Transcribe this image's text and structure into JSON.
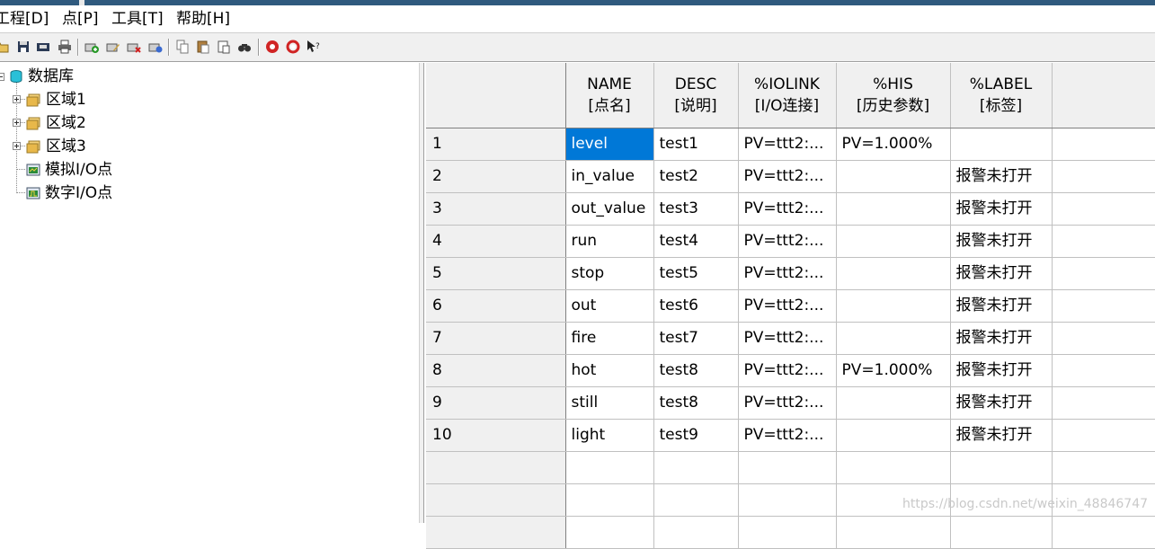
{
  "menu": [
    {
      "label": "工程[D]"
    },
    {
      "label": "点[P]"
    },
    {
      "label": "工具[T]"
    },
    {
      "label": "帮助[H]"
    }
  ],
  "toolbar": {
    "buttons": [
      {
        "icon": "open-folder-icon"
      },
      {
        "icon": "save-icon"
      },
      {
        "icon": "export-icon"
      },
      {
        "icon": "print-icon"
      },
      {
        "icon": "add-point-icon"
      },
      {
        "icon": "edit-point-icon"
      },
      {
        "icon": "delete-point-icon"
      },
      {
        "icon": "database-tool-icon"
      },
      {
        "icon": "copy-icon"
      },
      {
        "icon": "paste-icon"
      },
      {
        "icon": "paste-special-icon"
      },
      {
        "icon": "find-icon"
      },
      {
        "icon": "stop-icon"
      },
      {
        "icon": "help-ring-icon"
      },
      {
        "icon": "context-help-icon"
      }
    ]
  },
  "tree": {
    "root": {
      "label": "数据库"
    },
    "children": [
      {
        "label": "区域1"
      },
      {
        "label": "区域2"
      },
      {
        "label": "区域3"
      },
      {
        "label": "模拟I/O点"
      },
      {
        "label": "数字I/O点"
      }
    ]
  },
  "grid": {
    "columns": [
      {
        "name": "NAME",
        "sub": "[点名]"
      },
      {
        "name": "DESC",
        "sub": "[说明]"
      },
      {
        "name": "%IOLINK",
        "sub": "[I/O连接]"
      },
      {
        "name": "%HIS",
        "sub": "[历史参数]"
      },
      {
        "name": "%LABEL",
        "sub": "[标签]"
      }
    ],
    "rows": [
      {
        "num": "1",
        "name": "level",
        "desc": "test1",
        "iolink": "PV=ttt2:...",
        "his": "PV=1.000%",
        "label": ""
      },
      {
        "num": "2",
        "name": "in_value",
        "desc": "test2",
        "iolink": "PV=ttt2:...",
        "his": "",
        "label": "报警未打开"
      },
      {
        "num": "3",
        "name": "out_value",
        "desc": "test3",
        "iolink": "PV=ttt2:...",
        "his": "",
        "label": "报警未打开"
      },
      {
        "num": "4",
        "name": "run",
        "desc": "test4",
        "iolink": "PV=ttt2:...",
        "his": "",
        "label": "报警未打开"
      },
      {
        "num": "5",
        "name": "stop",
        "desc": "test5",
        "iolink": "PV=ttt2:...",
        "his": "",
        "label": "报警未打开"
      },
      {
        "num": "6",
        "name": "out",
        "desc": "test6",
        "iolink": "PV=ttt2:...",
        "his": "",
        "label": "报警未打开"
      },
      {
        "num": "7",
        "name": "fire",
        "desc": "test7",
        "iolink": "PV=ttt2:...",
        "his": "",
        "label": "报警未打开"
      },
      {
        "num": "8",
        "name": "hot",
        "desc": "test8",
        "iolink": "PV=ttt2:...",
        "his": "PV=1.000%",
        "label": "报警未打开"
      },
      {
        "num": "9",
        "name": "still",
        "desc": "test8",
        "iolink": "PV=ttt2:...",
        "his": "",
        "label": "报警未打开"
      },
      {
        "num": "10",
        "name": "light",
        "desc": "test9",
        "iolink": "PV=ttt2:...",
        "his": "",
        "label": "报警未打开"
      },
      {
        "num": "",
        "name": "",
        "desc": "",
        "iolink": "",
        "his": "",
        "label": ""
      },
      {
        "num": "",
        "name": "",
        "desc": "",
        "iolink": "",
        "his": "",
        "label": ""
      },
      {
        "num": "",
        "name": "",
        "desc": "",
        "iolink": "",
        "his": "",
        "label": ""
      }
    ]
  },
  "watermark": "https://blog.csdn.net/weixin_48846747",
  "colors": {
    "selection": "#0078d7",
    "titlebar": "#2f5a7e"
  }
}
